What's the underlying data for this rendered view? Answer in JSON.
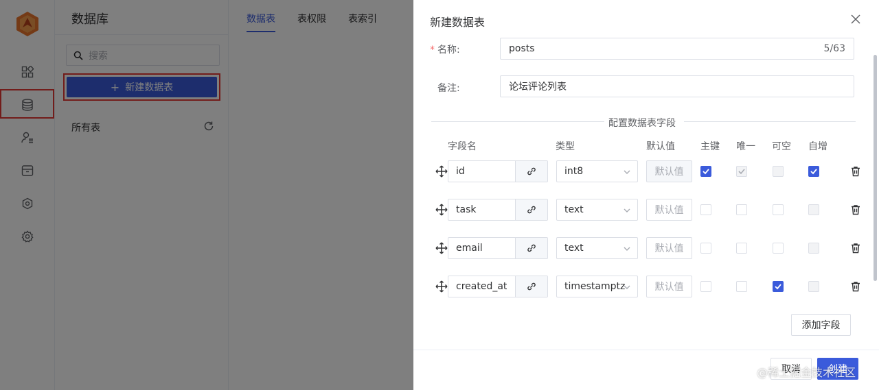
{
  "sidebar": {
    "logo": "app-logo",
    "items": [
      {
        "icon": "dashboard-icon"
      },
      {
        "icon": "database-icon",
        "active": true
      },
      {
        "icon": "user-list-icon"
      },
      {
        "icon": "storage-box-icon"
      },
      {
        "icon": "function-hex-icon"
      },
      {
        "icon": "gear-icon"
      }
    ]
  },
  "db_panel": {
    "title": "数据库",
    "search_placeholder": "搜索",
    "new_table_label": "新建数据表",
    "all_tables_label": "所有表"
  },
  "tabs": [
    {
      "label": "数据表",
      "active": true
    },
    {
      "label": "表权限"
    },
    {
      "label": "表索引"
    }
  ],
  "drawer": {
    "title": "新建数据表",
    "name_label": "名称:",
    "name_value": "posts",
    "name_count": "5/63",
    "note_label": "备注:",
    "note_value": "论坛评论列表",
    "section_title": "配置数据表字段",
    "columns": {
      "field_name": "字段名",
      "type": "类型",
      "default": "默认值",
      "primary": "主键",
      "unique": "唯一",
      "nullable": "可空",
      "auto_inc": "自增"
    },
    "default_placeholder": "默认值",
    "fields": [
      {
        "name": "id",
        "type": "int8",
        "primary": true,
        "unique": true,
        "nullable": false,
        "auto_inc": true
      },
      {
        "name": "task",
        "type": "text",
        "primary": false,
        "unique": false,
        "nullable": false,
        "auto_inc": false
      },
      {
        "name": "email",
        "type": "text",
        "primary": false,
        "unique": false,
        "nullable": false,
        "auto_inc": false
      },
      {
        "name": "created_at",
        "type": "timestamptz",
        "primary": false,
        "unique": false,
        "nullable": true,
        "auto_inc": false
      }
    ],
    "add_field_label": "添加字段",
    "cancel_label": "取消",
    "create_label": "创建"
  },
  "watermark": "@稀土掘金技术社区",
  "colors": {
    "accent": "#3b5bdb",
    "highlight": "#e53935"
  }
}
